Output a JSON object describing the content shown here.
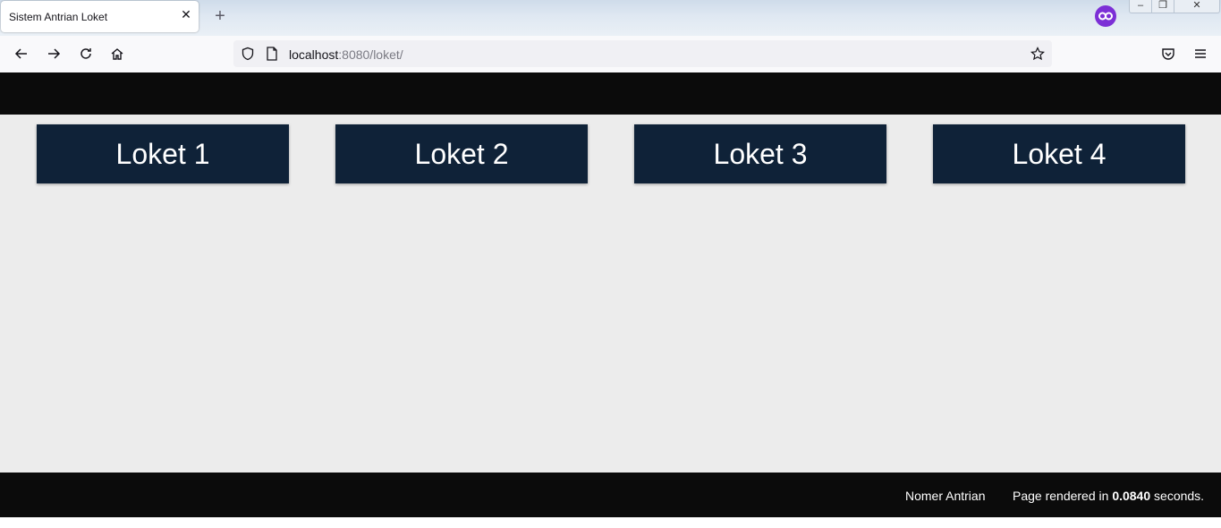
{
  "browser": {
    "tab_title": "Sistem Antrian Loket",
    "tab_close": "✕",
    "new_tab": "+",
    "url_host": "localhost",
    "url_rest": ":8080/loket/",
    "icons": [
      "back-arrow-icon",
      "forward-arrow-icon",
      "reload-icon",
      "home-icon",
      "shield-icon",
      "page-icon",
      "star-icon",
      "pocket-icon",
      "menu-icon",
      "private-browsing-icon"
    ],
    "private_color": "#7c2fd6"
  },
  "lokets": [
    {
      "label": "Loket 1"
    },
    {
      "label": "Loket 2"
    },
    {
      "label": "Loket 3"
    },
    {
      "label": "Loket 4"
    }
  ],
  "footer": {
    "nav_link": "Nomer Antrian",
    "rendered_prefix": "Page rendered in ",
    "rendered_time": "0.0840",
    "rendered_suffix": " seconds."
  },
  "colors": {
    "loket_bg": "#0f2238",
    "bar_bg": "#0b0b0b",
    "content_bg": "#ececec"
  }
}
